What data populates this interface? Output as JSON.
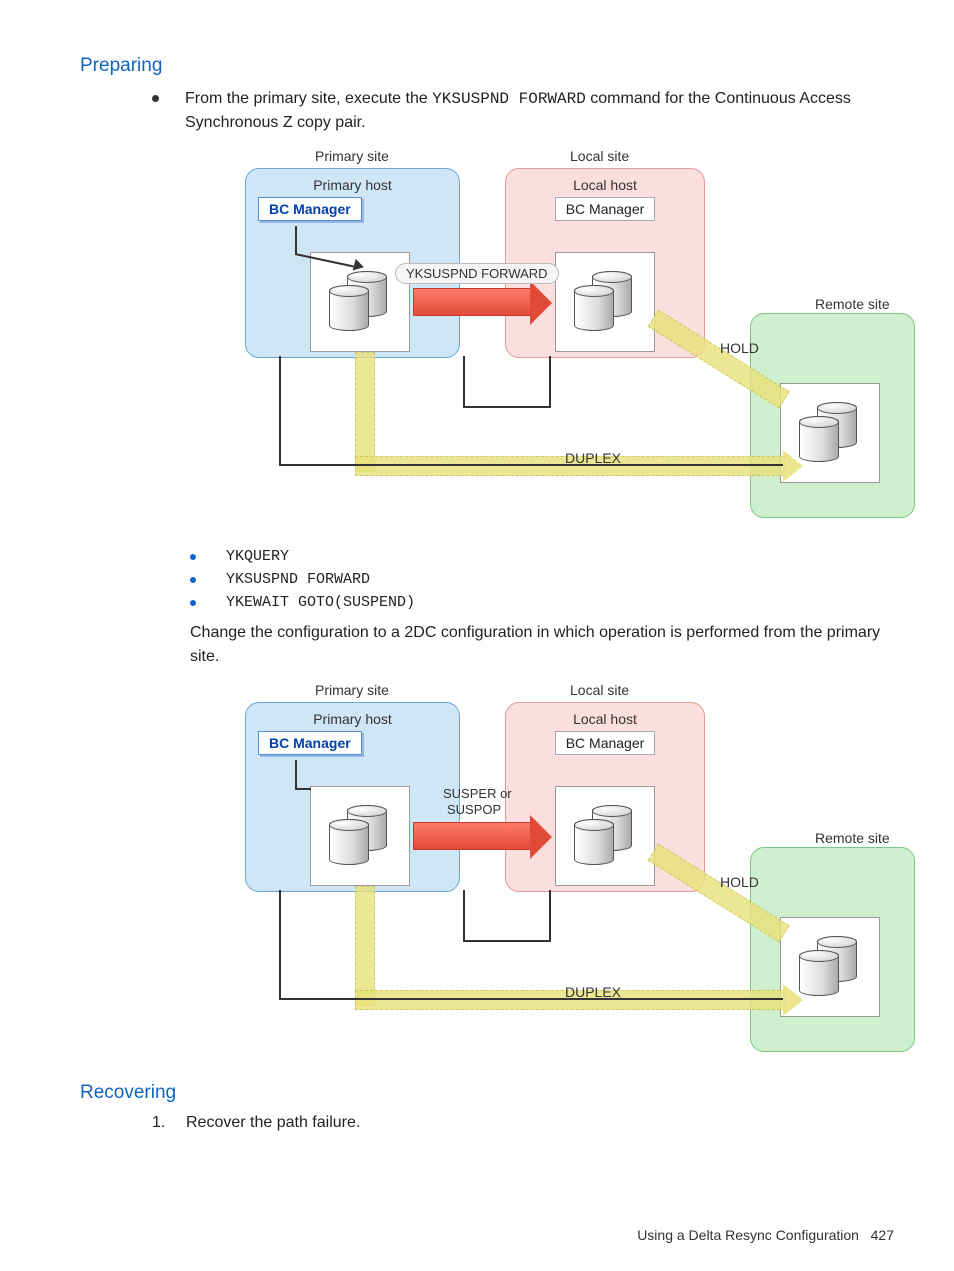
{
  "sections": {
    "preparing": "Preparing",
    "recovering": "Recovering"
  },
  "bullet1": {
    "pre": "From the primary site, execute the ",
    "cmd": "YKSUSPND FORWARD",
    "post": " command for the Continuous Access Synchronous Z copy pair."
  },
  "diagram1": {
    "primary_site": "Primary site",
    "local_site": "Local site",
    "remote_site": "Remote site",
    "primary_host": "Primary host",
    "local_host": "Local host",
    "bc_manager": "BC Manager",
    "cmd_pill": "YKSUSPND FORWARD",
    "hold": "HOLD",
    "duplex": "DUPLEX"
  },
  "commands": [
    "YKQUERY",
    "YKSUSPND FORWARD",
    "YKEWAIT GOTO(SUSPEND)"
  ],
  "paragraph2": "Change the configuration to a 2DC configuration in which operation is performed from the primary site.",
  "diagram2": {
    "primary_site": "Primary site",
    "local_site": "Local site",
    "remote_site": "Remote site",
    "primary_host": "Primary host",
    "local_host": "Local host",
    "bc_manager": "BC Manager",
    "susp_label1": "SUSPER or",
    "susp_label2": "SUSPOP",
    "hold": "HOLD",
    "duplex": "DUPLEX"
  },
  "recovering_step": {
    "num": "1.",
    "text": "Recover the path failure."
  },
  "footer": {
    "text": "Using a Delta Resync Configuration",
    "page": "427"
  }
}
